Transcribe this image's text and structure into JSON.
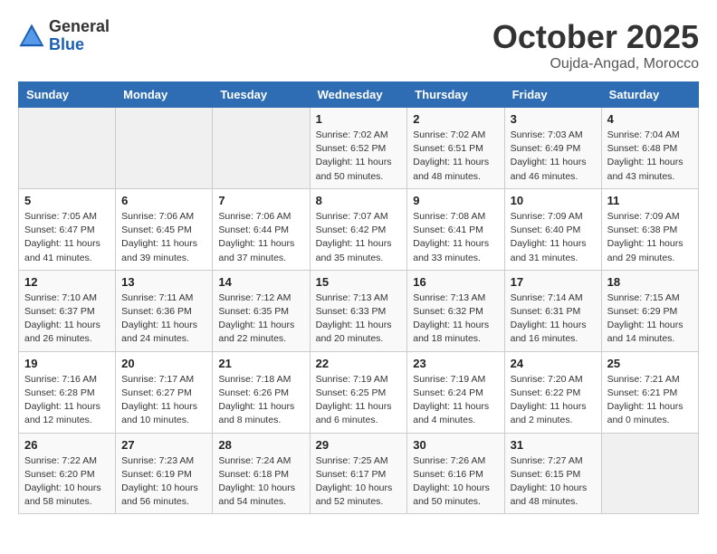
{
  "header": {
    "logo_general": "General",
    "logo_blue": "Blue",
    "month": "October 2025",
    "location": "Oujda-Angad, Morocco"
  },
  "weekdays": [
    "Sunday",
    "Monday",
    "Tuesday",
    "Wednesday",
    "Thursday",
    "Friday",
    "Saturday"
  ],
  "weeks": [
    [
      {
        "day": "",
        "info": ""
      },
      {
        "day": "",
        "info": ""
      },
      {
        "day": "",
        "info": ""
      },
      {
        "day": "1",
        "info": "Sunrise: 7:02 AM\nSunset: 6:52 PM\nDaylight: 11 hours and 50 minutes."
      },
      {
        "day": "2",
        "info": "Sunrise: 7:02 AM\nSunset: 6:51 PM\nDaylight: 11 hours and 48 minutes."
      },
      {
        "day": "3",
        "info": "Sunrise: 7:03 AM\nSunset: 6:49 PM\nDaylight: 11 hours and 46 minutes."
      },
      {
        "day": "4",
        "info": "Sunrise: 7:04 AM\nSunset: 6:48 PM\nDaylight: 11 hours and 43 minutes."
      }
    ],
    [
      {
        "day": "5",
        "info": "Sunrise: 7:05 AM\nSunset: 6:47 PM\nDaylight: 11 hours and 41 minutes."
      },
      {
        "day": "6",
        "info": "Sunrise: 7:06 AM\nSunset: 6:45 PM\nDaylight: 11 hours and 39 minutes."
      },
      {
        "day": "7",
        "info": "Sunrise: 7:06 AM\nSunset: 6:44 PM\nDaylight: 11 hours and 37 minutes."
      },
      {
        "day": "8",
        "info": "Sunrise: 7:07 AM\nSunset: 6:42 PM\nDaylight: 11 hours and 35 minutes."
      },
      {
        "day": "9",
        "info": "Sunrise: 7:08 AM\nSunset: 6:41 PM\nDaylight: 11 hours and 33 minutes."
      },
      {
        "day": "10",
        "info": "Sunrise: 7:09 AM\nSunset: 6:40 PM\nDaylight: 11 hours and 31 minutes."
      },
      {
        "day": "11",
        "info": "Sunrise: 7:09 AM\nSunset: 6:38 PM\nDaylight: 11 hours and 29 minutes."
      }
    ],
    [
      {
        "day": "12",
        "info": "Sunrise: 7:10 AM\nSunset: 6:37 PM\nDaylight: 11 hours and 26 minutes."
      },
      {
        "day": "13",
        "info": "Sunrise: 7:11 AM\nSunset: 6:36 PM\nDaylight: 11 hours and 24 minutes."
      },
      {
        "day": "14",
        "info": "Sunrise: 7:12 AM\nSunset: 6:35 PM\nDaylight: 11 hours and 22 minutes."
      },
      {
        "day": "15",
        "info": "Sunrise: 7:13 AM\nSunset: 6:33 PM\nDaylight: 11 hours and 20 minutes."
      },
      {
        "day": "16",
        "info": "Sunrise: 7:13 AM\nSunset: 6:32 PM\nDaylight: 11 hours and 18 minutes."
      },
      {
        "day": "17",
        "info": "Sunrise: 7:14 AM\nSunset: 6:31 PM\nDaylight: 11 hours and 16 minutes."
      },
      {
        "day": "18",
        "info": "Sunrise: 7:15 AM\nSunset: 6:29 PM\nDaylight: 11 hours and 14 minutes."
      }
    ],
    [
      {
        "day": "19",
        "info": "Sunrise: 7:16 AM\nSunset: 6:28 PM\nDaylight: 11 hours and 12 minutes."
      },
      {
        "day": "20",
        "info": "Sunrise: 7:17 AM\nSunset: 6:27 PM\nDaylight: 11 hours and 10 minutes."
      },
      {
        "day": "21",
        "info": "Sunrise: 7:18 AM\nSunset: 6:26 PM\nDaylight: 11 hours and 8 minutes."
      },
      {
        "day": "22",
        "info": "Sunrise: 7:19 AM\nSunset: 6:25 PM\nDaylight: 11 hours and 6 minutes."
      },
      {
        "day": "23",
        "info": "Sunrise: 7:19 AM\nSunset: 6:24 PM\nDaylight: 11 hours and 4 minutes."
      },
      {
        "day": "24",
        "info": "Sunrise: 7:20 AM\nSunset: 6:22 PM\nDaylight: 11 hours and 2 minutes."
      },
      {
        "day": "25",
        "info": "Sunrise: 7:21 AM\nSunset: 6:21 PM\nDaylight: 11 hours and 0 minutes."
      }
    ],
    [
      {
        "day": "26",
        "info": "Sunrise: 7:22 AM\nSunset: 6:20 PM\nDaylight: 10 hours and 58 minutes."
      },
      {
        "day": "27",
        "info": "Sunrise: 7:23 AM\nSunset: 6:19 PM\nDaylight: 10 hours and 56 minutes."
      },
      {
        "day": "28",
        "info": "Sunrise: 7:24 AM\nSunset: 6:18 PM\nDaylight: 10 hours and 54 minutes."
      },
      {
        "day": "29",
        "info": "Sunrise: 7:25 AM\nSunset: 6:17 PM\nDaylight: 10 hours and 52 minutes."
      },
      {
        "day": "30",
        "info": "Sunrise: 7:26 AM\nSunset: 6:16 PM\nDaylight: 10 hours and 50 minutes."
      },
      {
        "day": "31",
        "info": "Sunrise: 7:27 AM\nSunset: 6:15 PM\nDaylight: 10 hours and 48 minutes."
      },
      {
        "day": "",
        "info": ""
      }
    ]
  ]
}
